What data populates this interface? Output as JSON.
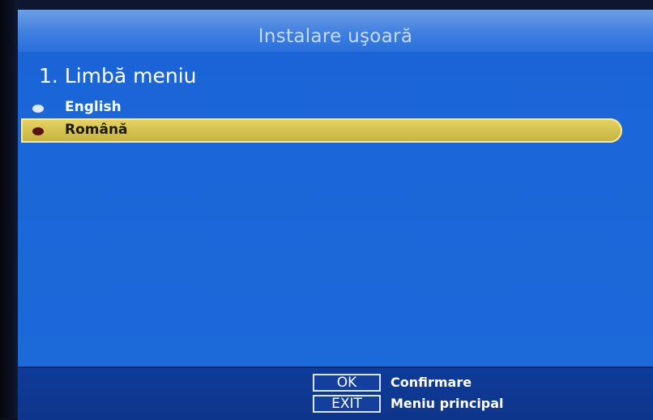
{
  "header": {
    "title": "Instalare uşoară"
  },
  "step": {
    "title": "1. Limbă meniu"
  },
  "languages": [
    {
      "label": "English",
      "selected": false
    },
    {
      "label": "Română",
      "selected": true
    }
  ],
  "footer": {
    "keys": [
      {
        "key": "OK",
        "action": "Confirmare"
      },
      {
        "key": "EXIT",
        "action": "Meniu principal"
      }
    ]
  },
  "colors": {
    "panel_blue": "#1b66d8",
    "highlight_yellow": "#d4c04e",
    "footer_blue": "#0f3c9a"
  },
  "icons": {
    "unselected_bullet": "bullet-icon",
    "selected_bullet": "bullet-icon"
  }
}
